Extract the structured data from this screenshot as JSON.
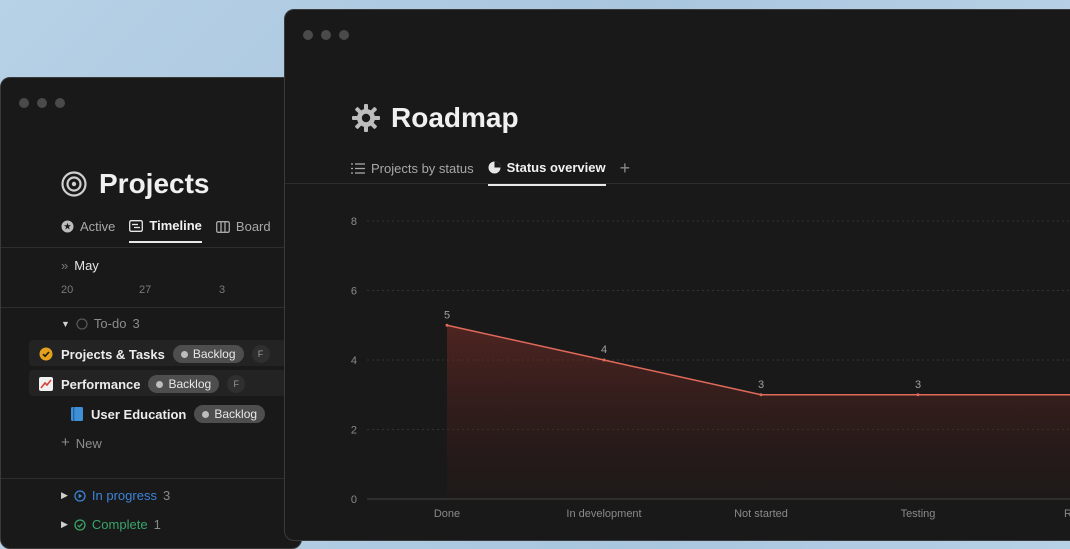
{
  "projects_window": {
    "title": "Projects",
    "tabs": [
      {
        "label": "Active",
        "icon": "star-circle-icon"
      },
      {
        "label": "Timeline",
        "icon": "timeline-icon",
        "active": true
      },
      {
        "label": "Board",
        "icon": "board-icon"
      }
    ],
    "month": "May",
    "days": [
      "20",
      "27",
      "3"
    ],
    "groups": {
      "todo": {
        "label": "To-do",
        "count": "3"
      },
      "in_progress": {
        "label": "In progress",
        "count": "3"
      },
      "complete": {
        "label": "Complete",
        "count": "1"
      }
    },
    "rows": [
      {
        "label": "Projects & Tasks",
        "icon": "check-badge-icon",
        "status": "Backlog",
        "avatar": "F"
      },
      {
        "label": "Performance",
        "icon": "chart-up-icon",
        "status": "Backlog",
        "avatar": "F"
      },
      {
        "label": "User Education",
        "icon": "book-icon",
        "status": "Backlog"
      }
    ],
    "new_label": "New"
  },
  "roadmap_window": {
    "title": "Roadmap",
    "tabs": [
      {
        "label": "Projects by status",
        "icon": "list-icon"
      },
      {
        "label": "Status overview",
        "icon": "pie-chart-icon",
        "active": true
      }
    ],
    "add_tab_label": "+"
  },
  "chart_data": {
    "type": "area",
    "categories": [
      "Done",
      "In development",
      "Not started",
      "Testing",
      "Revi"
    ],
    "values": [
      5,
      4,
      3,
      3,
      3
    ],
    "data_labels": [
      "5",
      "4",
      "3",
      "3"
    ],
    "yticks": [
      0,
      2,
      4,
      6,
      8
    ],
    "ylim": [
      0,
      8
    ],
    "title": "",
    "xlabel": "",
    "ylabel": "",
    "grid": true,
    "line_color": "#e06a5a"
  }
}
